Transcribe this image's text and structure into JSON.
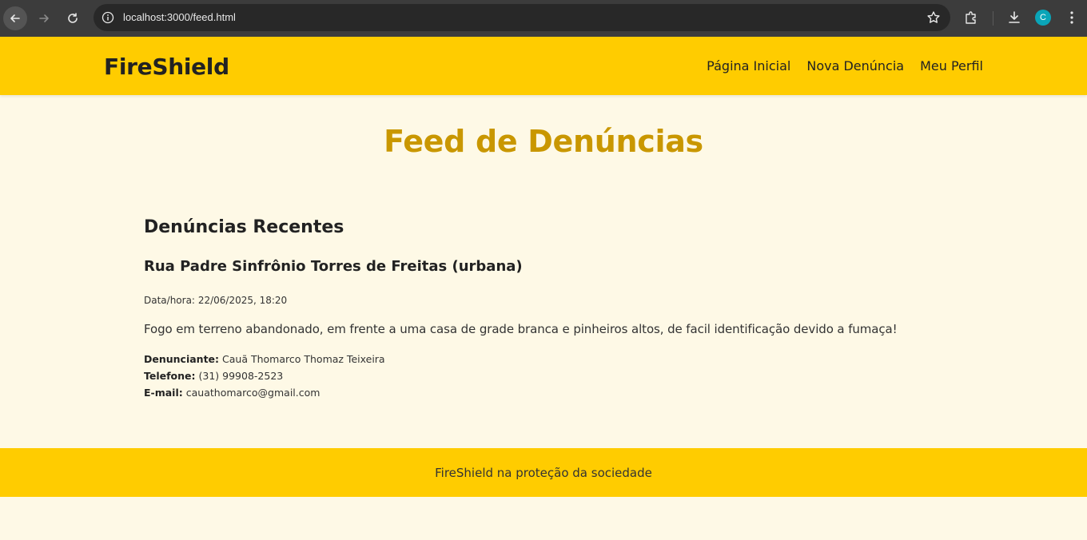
{
  "browser": {
    "url": "localhost:3000/feed.html",
    "profile_initial": "C"
  },
  "header": {
    "logo": "FireShield",
    "nav": [
      {
        "label": "Página Inicial"
      },
      {
        "label": "Nova Denúncia"
      },
      {
        "label": "Meu Perfil"
      }
    ]
  },
  "main": {
    "title": "Feed de Denúncias",
    "section_title": "Denúncias Recentes",
    "report": {
      "title": "Rua Padre Sinfrônio Torres de Freitas (urbana)",
      "date_label": "Data/hora:",
      "date_value": "22/06/2025, 18:20",
      "description": "Fogo em terreno abandonado, em frente a uma casa de grade branca e pinheiros altos, de facil identificação devido a fumaça!",
      "reporter_label": "Denunciante:",
      "reporter_value": "Cauã Thomarco Thomaz Teixeira",
      "phone_label": "Telefone:",
      "phone_value": "(31) 99908-2523",
      "email_label": "E-mail:",
      "email_value": "cauathomarco@gmail.com"
    }
  },
  "footer": {
    "text": "FireShield na proteção da sociedade"
  },
  "colors": {
    "header_bg": "#ffcc00",
    "page_bg": "#fef9e6",
    "title": "#c99700"
  }
}
